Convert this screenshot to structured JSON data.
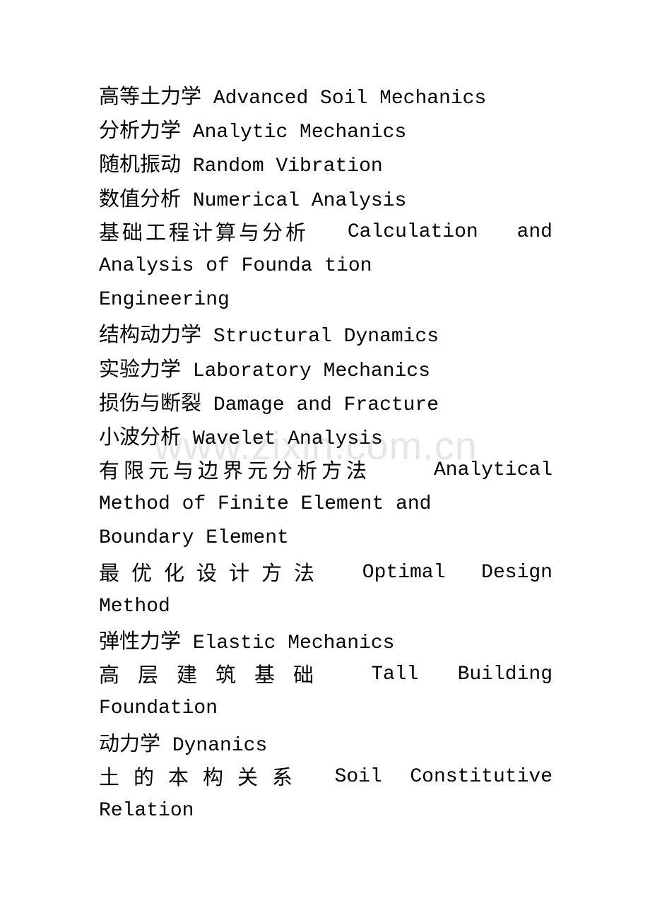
{
  "watermark": "www.zixin.com.cn",
  "entries": [
    {
      "cn": "高等土力学",
      "en": "Advanced Soil Mechanics"
    },
    {
      "cn": "分析力学",
      "en": "Analytic Mechanics"
    },
    {
      "cn": "随机振动",
      "en": "Random Vibration"
    },
    {
      "cn": "数值分析",
      "en": "Numerical Analysis"
    },
    {
      "cn": "基础工程计算与分析",
      "en_line1_a": "Calculation",
      "en_line1_b": "and",
      "en_line2": "Analysis of Founda tion",
      "en_line3": "Engineering"
    },
    {
      "cn": "结构动力学",
      "en": "Structural Dynamics"
    },
    {
      "cn": "实验力学",
      "en": "Laboratory Mechanics"
    },
    {
      "cn": "损伤与断裂",
      "en": "Damage and Fracture"
    },
    {
      "cn": "小波分析",
      "en": "Wavelet Analysis"
    },
    {
      "cn": "有限元与边界元分析方法",
      "en_line1": "Analytical",
      "en_line2": "Method of Finite Element and",
      "en_line3": "Boundary Element"
    },
    {
      "cn": "最优化设计方法",
      "en_line1_a": "Optimal",
      "en_line1_b": "Design",
      "en_line2": "Method"
    },
    {
      "cn": "弹性力学",
      "en": "Elastic Mechanics"
    },
    {
      "cn": "高层建筑基础",
      "en_line1_a": "Tall",
      "en_line1_b": "Building",
      "en_line2": "Foundation"
    },
    {
      "cn": "动力学",
      "en": "Dynanics"
    },
    {
      "cn": "土的本构关系",
      "en_line1_a": "Soil",
      "en_line1_b": "Constitutive",
      "en_line2": "Relation"
    }
  ]
}
